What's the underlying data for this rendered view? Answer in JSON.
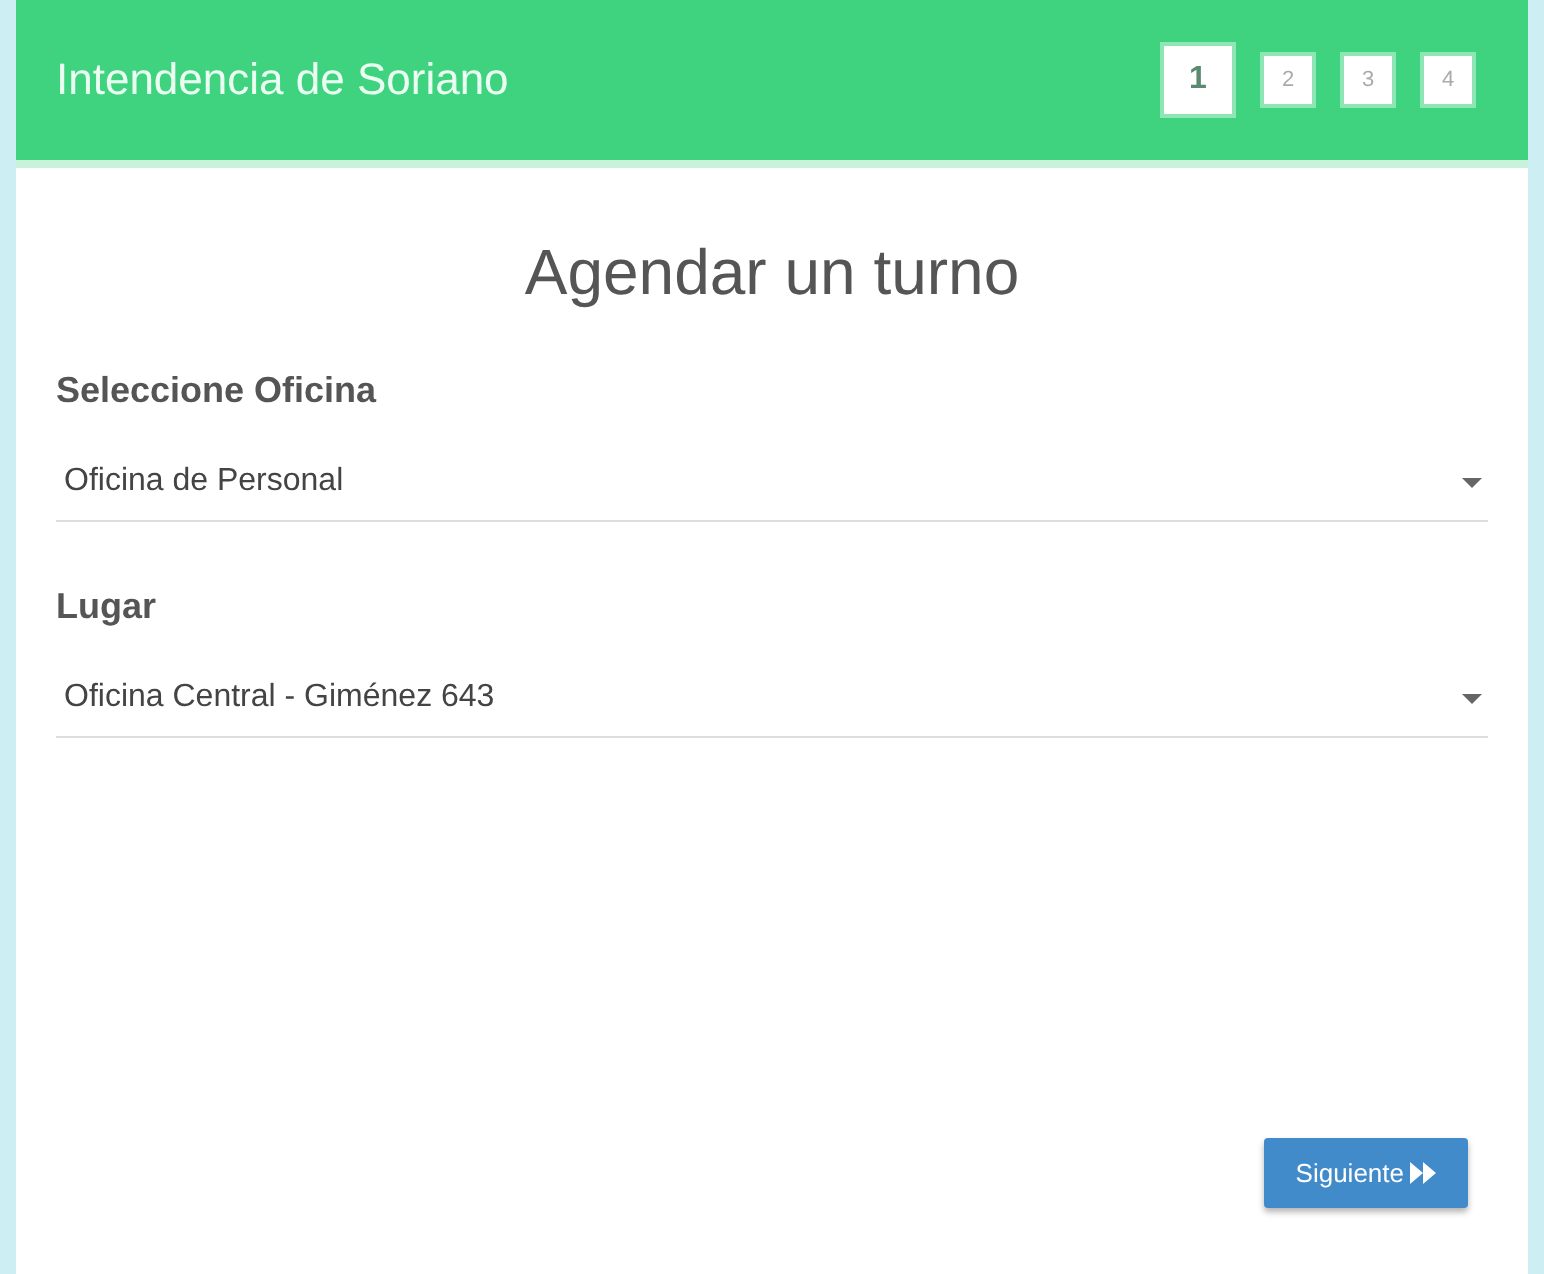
{
  "header": {
    "title": "Intendencia de Soriano",
    "steps": [
      {
        "label": "1",
        "selected": true
      },
      {
        "label": "2",
        "selected": false
      },
      {
        "label": "3",
        "selected": false
      },
      {
        "label": "4",
        "selected": false
      }
    ]
  },
  "form": {
    "title": "Agendar un turno",
    "fields": [
      {
        "label": "Seleccione Oficina",
        "value": "Oficina de Personal"
      },
      {
        "label": "Lugar",
        "value": "Oficina Central - Giménez 643"
      }
    ],
    "next_button": {
      "label": "Siguiente"
    }
  }
}
